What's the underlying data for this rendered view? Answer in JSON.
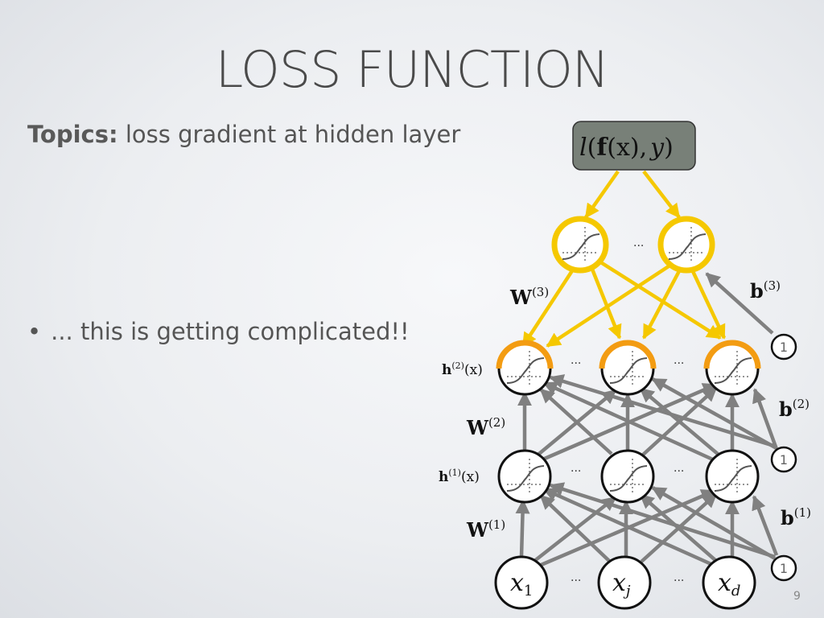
{
  "slide": {
    "title": "LOSS FUNCTION",
    "topics_label": "Topics:",
    "topics_text": "loss gradient at hidden layer",
    "bullet_symbol": "•",
    "bullet_text": "... this is getting complicated!!",
    "page_number": "9"
  },
  "diagram": {
    "loss": {
      "l": "l",
      "open": "(",
      "f": "f",
      "x": "(x)",
      "comma": ",",
      "y": "y",
      "close": ")"
    },
    "weights": [
      {
        "base": "W",
        "sup": "(3)"
      },
      {
        "base": "W",
        "sup": "(2)"
      },
      {
        "base": "W",
        "sup": "(1)"
      }
    ],
    "biases": [
      {
        "base": "b",
        "sup": "(3)"
      },
      {
        "base": "b",
        "sup": "(2)"
      },
      {
        "base": "b",
        "sup": "(1)"
      }
    ],
    "hidden_labels": [
      {
        "base": "h",
        "sup": "(2)",
        "arg": "(x)"
      },
      {
        "base": "h",
        "sup": "(1)",
        "arg": "(x)"
      }
    ],
    "inputs": [
      {
        "base": "x",
        "sub": "1"
      },
      {
        "base": "x",
        "sub": "j"
      },
      {
        "base": "x",
        "sub": "d"
      }
    ],
    "bias_unit_label": "1",
    "ellipsis": "...",
    "colors": {
      "forward_arrow": "#808080",
      "gradient_arrow": "#f5c800",
      "gradient_node": "#f5c800",
      "hidden_highlight": "#f39c12",
      "loss_box_fill": "#788078",
      "node_stroke": "#111111"
    }
  }
}
